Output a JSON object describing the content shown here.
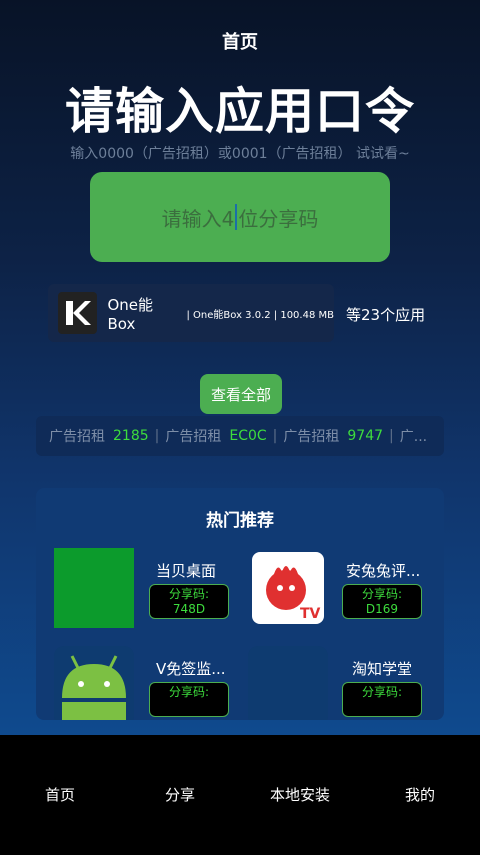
{
  "header": {
    "title": "首页"
  },
  "headline": "请输入应用口令",
  "hint": "输入0000（广告招租）或0001（广告招租） 试试看~",
  "code_input": {
    "text_before": "请输入4",
    "text_after": "位分享码"
  },
  "app_card": {
    "logo_letter": "K",
    "name": "One能Box",
    "meta": "| One能Box 3.0.2 | 100.48 MB",
    "count": "等23个应用"
  },
  "view_all_label": "查看全部",
  "ticker": {
    "items": [
      {
        "label": "广告招租",
        "code": "2185"
      },
      {
        "label": "广告招租",
        "code": "EC0C"
      },
      {
        "label": "广告招租",
        "code": "9747"
      },
      {
        "label": "广..."
      }
    ]
  },
  "hot": {
    "title": "热门推荐",
    "items": [
      {
        "name": "当贝桌面",
        "share_label": "分享码:",
        "code": "748D",
        "icon": "green-square-icon"
      },
      {
        "name": "安兔兔评...",
        "share_label": "分享码:",
        "code": "D169",
        "icon": "antutu-icon"
      },
      {
        "name": "V免签监...",
        "share_label": "分享码:",
        "code": "",
        "icon": "android-icon"
      },
      {
        "name": "淘知学堂",
        "share_label": "分享码:",
        "code": "",
        "icon": "blank-icon"
      }
    ]
  },
  "nav": {
    "home": "首页",
    "share": "分享",
    "local_install": "本地安装",
    "mine": "我的"
  },
  "colors": {
    "accent": "#4cae51",
    "code_green": "#3ddc3d"
  }
}
